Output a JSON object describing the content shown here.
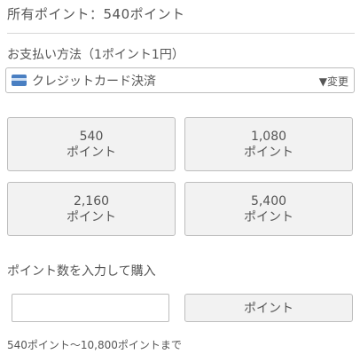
{
  "owned_points_text": "所有ポイント：540ポイント",
  "payment": {
    "label": "お支払い方法（1ポイント1円）",
    "icon": "credit-card-icon",
    "method": "クレジットカード決済",
    "change_label": "▼変更"
  },
  "tiles": [
    {
      "amount": "540",
      "unit": "ポイント"
    },
    {
      "amount": "1,080",
      "unit": "ポイント"
    },
    {
      "amount": "2,160",
      "unit": "ポイント"
    },
    {
      "amount": "5,400",
      "unit": "ポイント"
    }
  ],
  "custom": {
    "label": "ポイント数を入力して購入",
    "input_value": "",
    "button_label": "ポイント"
  },
  "range_note": "540ポイント〜10,800ポイントまで"
}
